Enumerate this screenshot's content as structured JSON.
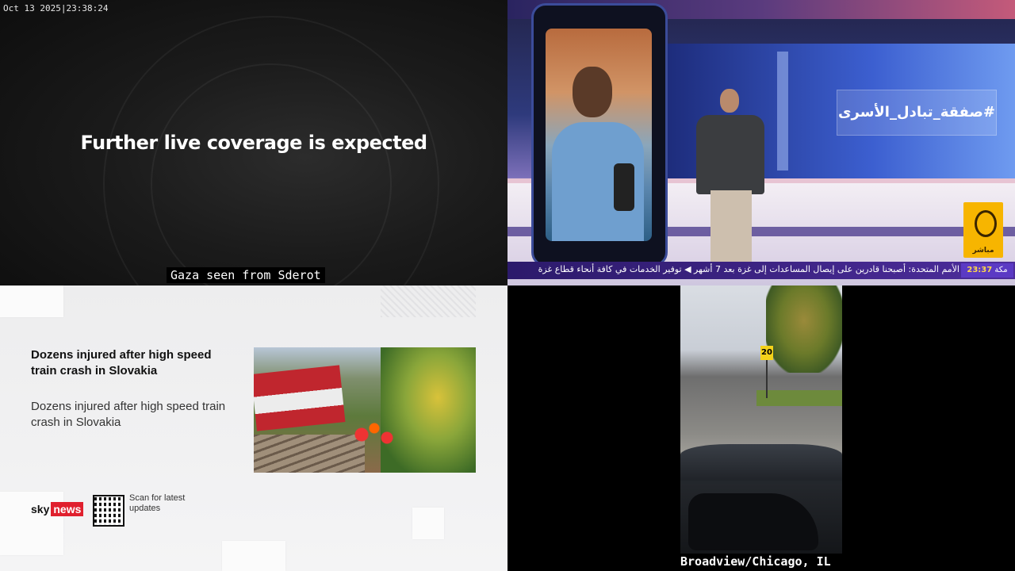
{
  "top_left": {
    "timestamp": "Oct 13 2025|23:38:24",
    "headline": "Further live coverage is expected",
    "caption": "Gaza seen from Sderot"
  },
  "top_right": {
    "hashtag": "#صفقة_تبادل_الأسرى",
    "logo_text": "مباشر",
    "ticker_text": "الأمم المتحدة: أصبحنا قادرين على إيصال المساعدات إلى غزة بعد 7 أشهر ◀ توفير الخدمات في كافة أنحاء قطاع غزة",
    "ticker_clock_city": "مكة",
    "ticker_clock_time": "23:37"
  },
  "bottom_left": {
    "title": "Dozens injured after high speed train crash in Slovakia",
    "subtitle": "Dozens injured after high speed train crash in Slovakia",
    "brand_sky": "sky",
    "brand_news": "news",
    "scan_text": "Scan for latest updates"
  },
  "bottom_right": {
    "sign_value": "20",
    "caption": "Broadview/Chicago, IL"
  }
}
